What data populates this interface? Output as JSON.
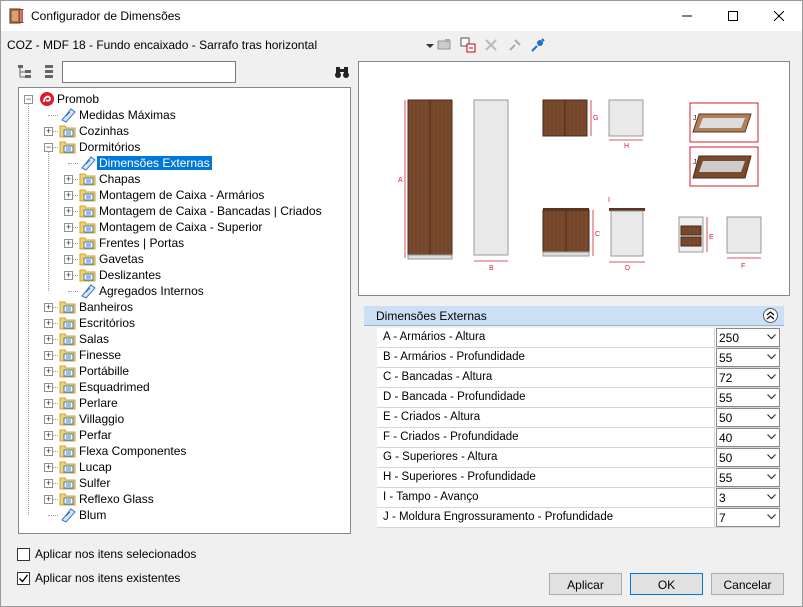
{
  "window": {
    "title": "Configurador de Dimensões"
  },
  "toolbar": {
    "breadcrumb": "COZ - MDF 18 - Fundo encaixado - Sarrafo tras horizontal"
  },
  "search": {
    "value": ""
  },
  "tree": {
    "items": [
      {
        "label": "Promob"
      },
      {
        "label": "Medidas Máximas"
      },
      {
        "label": "Cozinhas"
      },
      {
        "label": "Dormitórios"
      },
      {
        "label": "Dimensões Externas"
      },
      {
        "label": "Chapas"
      },
      {
        "label": "Montagem de Caixa - Armários"
      },
      {
        "label": "Montagem de Caixa - Bancadas | Criados"
      },
      {
        "label": "Montagem de Caixa - Superior"
      },
      {
        "label": "Frentes | Portas"
      },
      {
        "label": "Gavetas"
      },
      {
        "label": "Deslizantes"
      },
      {
        "label": "Agregados Internos"
      },
      {
        "label": "Banheiros"
      },
      {
        "label": "Escritórios"
      },
      {
        "label": "Salas"
      },
      {
        "label": "Finesse"
      },
      {
        "label": "Portábille"
      },
      {
        "label": "Esquadrimed"
      },
      {
        "label": "Perlare"
      },
      {
        "label": "Villaggio"
      },
      {
        "label": "Perfar"
      },
      {
        "label": "Flexa Componentes"
      },
      {
        "label": "Lucap"
      },
      {
        "label": "Sulfer"
      },
      {
        "label": "Reflexo Glass"
      },
      {
        "label": "Blum"
      }
    ]
  },
  "preview": {
    "labels": {
      "a": "A",
      "b": "B",
      "c": "C",
      "d": "D",
      "e": "E",
      "f": "F",
      "g": "G",
      "h": "H",
      "i": "I",
      "j1": "J",
      "j2": "J"
    }
  },
  "section": {
    "title": "Dimensões Externas"
  },
  "properties": [
    {
      "name": "A - Armários - Altura",
      "value": "250"
    },
    {
      "name": "B - Armários - Profundidade",
      "value": "55"
    },
    {
      "name": "C - Bancadas - Altura",
      "value": "72"
    },
    {
      "name": "D - Bancada - Profundidade",
      "value": "55"
    },
    {
      "name": "E - Criados - Altura",
      "value": "50"
    },
    {
      "name": "F - Criados - Profundidade",
      "value": "40"
    },
    {
      "name": "G - Superiores - Altura",
      "value": "50"
    },
    {
      "name": "H - Superiores - Profundidade",
      "value": "55"
    },
    {
      "name": "I - Tampo - Avanço",
      "value": "3"
    },
    {
      "name": "J - Moldura Engrossuramento - Profundidade",
      "value": "7"
    }
  ],
  "options": {
    "apply_selected": {
      "label": "Aplicar nos itens selecionados",
      "checked": false
    },
    "apply_existing": {
      "label": "Aplicar nos itens existentes",
      "checked": true
    }
  },
  "buttons": {
    "apply": "Aplicar",
    "ok": "OK",
    "cancel": "Cancelar"
  },
  "colors": {
    "wood": "#7a4a2e",
    "selection": "#0078d7",
    "header": "#cce0f5",
    "dim_red": "#d02030"
  }
}
